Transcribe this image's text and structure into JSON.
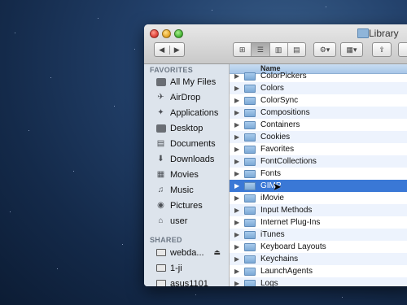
{
  "window": {
    "title": "Library"
  },
  "toolbar": {
    "back_icon": "back-arrow",
    "forward_icon": "forward-arrow",
    "view_icons": [
      "icon-view",
      "list-view",
      "column-view",
      "cover-flow-view"
    ],
    "action_glyph": "⚙▾",
    "arrange_glyph": "▦▾",
    "share_glyph": "⇪"
  },
  "sidebar": {
    "favorites_header": "FAVORITES",
    "favorites": [
      {
        "label": "All My Files",
        "icon": "all-files-icon"
      },
      {
        "label": "AirDrop",
        "icon": "airdrop-icon"
      },
      {
        "label": "Applications",
        "icon": "applications-icon"
      },
      {
        "label": "Desktop",
        "icon": "desktop-icon"
      },
      {
        "label": "Documents",
        "icon": "documents-icon"
      },
      {
        "label": "Downloads",
        "icon": "downloads-icon"
      },
      {
        "label": "Movies",
        "icon": "movies-icon"
      },
      {
        "label": "Music",
        "icon": "music-icon"
      },
      {
        "label": "Pictures",
        "icon": "pictures-icon"
      },
      {
        "label": "user",
        "icon": "home-icon"
      }
    ],
    "shared_header": "SHARED",
    "shared": [
      {
        "label": "webda...",
        "icon": "monitor-icon",
        "eject": "⏏"
      },
      {
        "label": "1-ji",
        "icon": "monitor-icon"
      },
      {
        "label": "asus1101",
        "icon": "monitor-icon"
      }
    ]
  },
  "list": {
    "column_name": "Name",
    "selected": "GIMP",
    "items": [
      "ColorPickers",
      "Colors",
      "ColorSync",
      "Compositions",
      "Containers",
      "Cookies",
      "Favorites",
      "FontCollections",
      "Fonts",
      "GIMP",
      "iMovie",
      "Input Methods",
      "Internet Plug-Ins",
      "iTunes",
      "Keyboard Layouts",
      "Keychains",
      "LaunchAgents",
      "Logs"
    ]
  }
}
